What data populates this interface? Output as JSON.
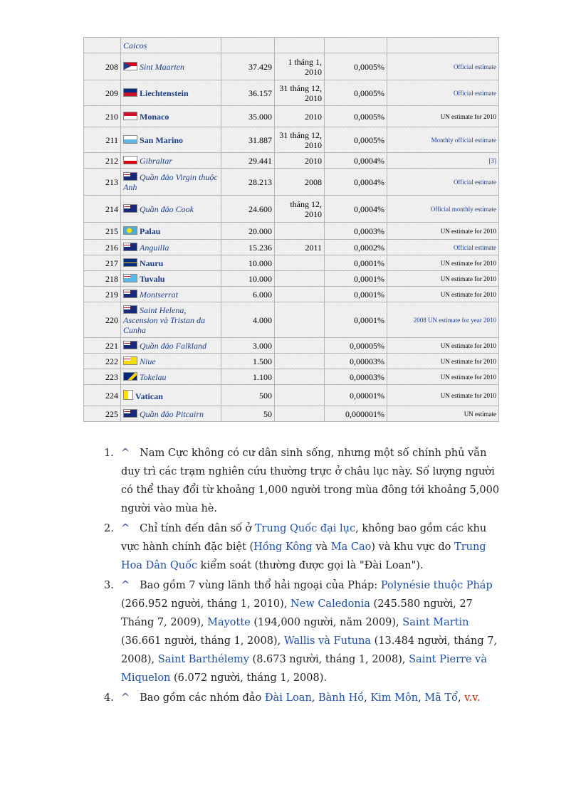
{
  "table": {
    "rows": [
      {
        "rank": "",
        "flag": "none",
        "name": "Caicos",
        "bold": false,
        "pop": "",
        "date": "",
        "pct": "",
        "src": "",
        "src_link": true
      },
      {
        "rank": "208",
        "flag": "sint",
        "name": "Sint Maarten",
        "bold": false,
        "pop": "37.429",
        "date": "1 tháng 1, 2010",
        "pct": "0,0005%",
        "src": "Official estimate",
        "src_link": true
      },
      {
        "rank": "209",
        "flag": "liech",
        "name": "Liechtenstein",
        "bold": true,
        "pop": "36.157",
        "date": "31 tháng 12, 2010",
        "pct": "0,0005%",
        "src": "Official estimate",
        "src_link": true
      },
      {
        "rank": "210",
        "flag": "monaco",
        "name": "Monaco",
        "bold": true,
        "pop": "35.000",
        "date": "2010",
        "pct": "0,0005%",
        "src": "UN estimate for 2010",
        "src_link": false
      },
      {
        "rank": "211",
        "flag": "sanm",
        "name": "San Marino",
        "bold": true,
        "pop": "31.887",
        "date": "31 tháng 12, 2010",
        "pct": "0,0005%",
        "src": "Monthly official estimate",
        "src_link": true
      },
      {
        "rank": "212",
        "flag": "gib",
        "name": "Gibraltar",
        "bold": false,
        "pop": "29.441",
        "date": "2010",
        "pct": "0,0004%",
        "src": "[3]",
        "src_link": true
      },
      {
        "rank": "213",
        "flag": "blue",
        "name": "Quần đảo Virgin thuộc Anh",
        "bold": false,
        "pop": "28.213",
        "date": "2008",
        "pct": "0,0004%",
        "src": "Official estimate",
        "src_link": true
      },
      {
        "rank": "214",
        "flag": "blue",
        "name": "Quần đảo Cook",
        "bold": false,
        "pop": "24.600",
        "date": "tháng 12, 2010",
        "pct": "0,0004%",
        "src": "Official monthly estimate",
        "src_link": true
      },
      {
        "rank": "215",
        "flag": "palau",
        "name": "Palau",
        "bold": true,
        "pop": "20.000",
        "date": "",
        "pct": "0,0003%",
        "src": "UN estimate for 2010",
        "src_link": false
      },
      {
        "rank": "216",
        "flag": "blue",
        "name": "Anguilla",
        "bold": false,
        "pop": "15.236",
        "date": "2011",
        "pct": "0,0002%",
        "src": "Official estimate",
        "src_link": true
      },
      {
        "rank": "217",
        "flag": "nauru",
        "name": "Nauru",
        "bold": true,
        "pop": "10.000",
        "date": "",
        "pct": "0,0001%",
        "src": "UN estimate for 2010",
        "src_link": false
      },
      {
        "rank": "218",
        "flag": "tuvalu",
        "name": "Tuvalu",
        "bold": true,
        "pop": "10.000",
        "date": "",
        "pct": "0,0001%",
        "src": "UN estimate for 2010",
        "src_link": false
      },
      {
        "rank": "219",
        "flag": "blue",
        "name": "Montserrat",
        "bold": false,
        "pop": "6.000",
        "date": "",
        "pct": "0,0001%",
        "src": "UN estimate for 2010",
        "src_link": false
      },
      {
        "rank": "220",
        "flag": "blue",
        "name": "Saint Helena, Ascension và Tristan da Cunha",
        "bold": false,
        "pop": "4.000",
        "date": "",
        "pct": "0,0001%",
        "src": "2008 UN estimate for year 2010",
        "src_link": true
      },
      {
        "rank": "221",
        "flag": "blue",
        "name": "Quần đảo Falkland",
        "bold": false,
        "pop": "3.000",
        "date": "",
        "pct": "0,00005%",
        "src": "UN estimate for 2010",
        "src_link": false
      },
      {
        "rank": "222",
        "flag": "niue",
        "name": "Niue",
        "bold": false,
        "pop": "1.500",
        "date": "",
        "pct": "0,00003%",
        "src": "UN estimate for 2010",
        "src_link": false
      },
      {
        "rank": "223",
        "flag": "tok",
        "name": "Tokelau",
        "bold": false,
        "pop": "1.100",
        "date": "",
        "pct": "0,00003%",
        "src": "UN estimate for 2010",
        "src_link": false
      },
      {
        "rank": "224",
        "flag": "vat",
        "name": "Vatican",
        "bold": true,
        "pop": "500",
        "date": "",
        "pct": "0,00001%",
        "src": "UN estimate for 2010",
        "src_link": false
      },
      {
        "rank": "225",
        "flag": "blue",
        "name": "Quần đảo Pitcairn",
        "bold": false,
        "pop": "50",
        "date": "",
        "pct": "0,000001%",
        "src": "UN estimate",
        "src_link": false
      }
    ]
  },
  "notes": [
    {
      "num": "1.",
      "caret": "^",
      "parts": [
        {
          "t": "Nam Cực không có cư dân sinh sống, nhưng một số chính phủ vẫn duy trì các trạm nghiên cứu thường trực ở châu lục này. Số lượng người có thể thay đổi từ khoảng 1,000 người trong mùa đông tới khoảng 5,000 người vào mùa hè.",
          "link": false
        }
      ]
    },
    {
      "num": "2.",
      "caret": "^",
      "parts": [
        {
          "t": "Chỉ tính đến dân số ở ",
          "link": false
        },
        {
          "t": "Trung Quốc đại lục",
          "link": true
        },
        {
          "t": ", không bao gồm các khu vực hành chính đặc biệt (",
          "link": false
        },
        {
          "t": "Hồng Kông",
          "link": true
        },
        {
          "t": " và ",
          "link": false
        },
        {
          "t": "Ma Cao",
          "link": true
        },
        {
          "t": ") và khu vực do ",
          "link": false
        },
        {
          "t": "Trung Hoa Dân Quốc",
          "link": true
        },
        {
          "t": " kiểm soát (thường được gọi là \"Đài Loan\").",
          "link": false
        }
      ]
    },
    {
      "num": "3.",
      "caret": "^",
      "parts": [
        {
          "t": "Bao gồm 7 vùng lãnh thổ hải ngoại của Pháp: ",
          "link": false
        },
        {
          "t": "Polynésie thuộc Pháp",
          "link": true
        },
        {
          "t": " (266.952 người, tháng 1, 2010), ",
          "link": false
        },
        {
          "t": "New Caledonia",
          "link": true
        },
        {
          "t": " (245.580 người, 27 Tháng 7, 2009), ",
          "link": false
        },
        {
          "t": "Mayotte",
          "link": true
        },
        {
          "t": " (194,000 người, năm 2009), ",
          "link": false
        },
        {
          "t": "Saint Martin",
          "link": true
        },
        {
          "t": " (36.661 người, tháng 1, 2008), ",
          "link": false
        },
        {
          "t": "Wallis và Futuna",
          "link": true
        },
        {
          "t": " (13.484 người, tháng 7, 2008), ",
          "link": false
        },
        {
          "t": "Saint Barthélemy",
          "link": true
        },
        {
          "t": " (8.673 người, tháng 1, 2008), ",
          "link": false
        },
        {
          "t": "Saint Pierre và Miquelon",
          "link": true
        },
        {
          "t": " (6.072 người, tháng 1, 2008).",
          "link": false
        }
      ]
    },
    {
      "num": "4.",
      "caret": "^",
      "parts": [
        {
          "t": "Bao gồm các nhóm đảo ",
          "link": false
        },
        {
          "t": "Đài Loan",
          "link": true
        },
        {
          "t": ", ",
          "link": false
        },
        {
          "t": "Bành Hồ",
          "link": true
        },
        {
          "t": ", ",
          "link": false
        },
        {
          "t": "Kim Môn",
          "link": true
        },
        {
          "t": ", ",
          "link": false
        },
        {
          "t": "Mã Tổ",
          "link": true
        },
        {
          "t": ", ",
          "link": false
        },
        {
          "t": "v.v.",
          "link": "red"
        }
      ]
    }
  ]
}
